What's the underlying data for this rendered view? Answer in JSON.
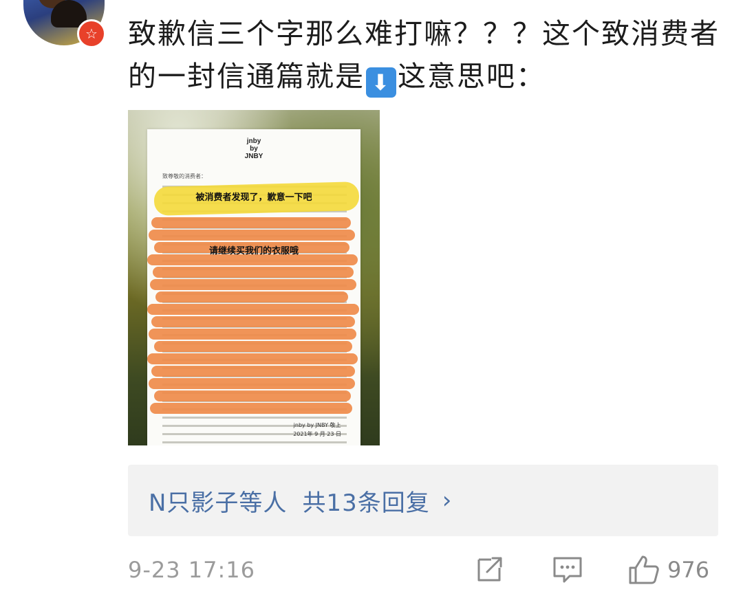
{
  "comment": {
    "text_part1": "致歉信三个字那么难打嘛？？？这个致消费者的一封信通篇就是",
    "emoji_down": "⬇",
    "text_part2": "这意思吧："
  },
  "image": {
    "letter": {
      "brand_lines": [
        "jnby",
        "by",
        "JNBY"
      ],
      "salutation": "致尊敬的消费者：",
      "annotation_top": "被消费者发现了，歉意一下吧",
      "annotation_mid": "请继续买我们的衣服哦",
      "signature": "jnby by JNBY 敬上",
      "date": "2021年 9 月 23 日"
    }
  },
  "replies": {
    "users": "N只影子等人",
    "count": "共13条回复",
    "chevron": "›"
  },
  "footer": {
    "timestamp": "9-23 17:16",
    "like_count": "976"
  },
  "icons": {
    "verified": "verified-badge-icon",
    "share": "share-icon",
    "reply": "comment-icon",
    "like": "thumbs-up-icon"
  }
}
